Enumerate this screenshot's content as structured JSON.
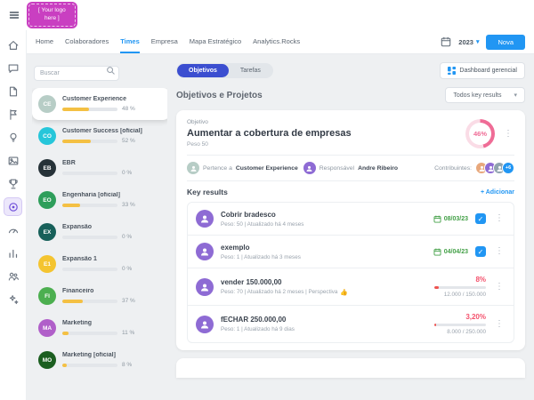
{
  "icons": {
    "kebab": "⋮",
    "check": "✓",
    "caret_down": "▾",
    "thumb_up": "👍"
  },
  "colors": {
    "logo_magenta": "#c93fc1",
    "accent_blue": "#2196f3",
    "pill_indigo": "#3b4ed0",
    "progress_yellow": "#f4c043",
    "danger_pink": "#f4516c",
    "ring_pink": "#ef6c96",
    "success_green": "#43a047",
    "active_icon_purple": "#6c4bd8"
  },
  "header": {
    "logo_line1": "[ Your logo",
    "logo_line2": "here ]"
  },
  "topnav": {
    "items": [
      {
        "label": "Home"
      },
      {
        "label": "Colaboradores"
      },
      {
        "label": "Times"
      },
      {
        "label": "Empresa"
      },
      {
        "label": "Mapa Estratégico"
      },
      {
        "label": "Analytics.Rocks"
      }
    ],
    "year": "2023",
    "new_button_label": "Nova"
  },
  "teams_panel": {
    "search_placeholder": "Buscar",
    "teams": [
      {
        "initials": "CE",
        "name": "Customer Experience",
        "percent": "48 %",
        "value": 48,
        "color": "#b7cdc6"
      },
      {
        "initials": "CO",
        "name": "Customer Success [oficial]",
        "percent": "52 %",
        "value": 52,
        "color": "#26c6da"
      },
      {
        "initials": "EB",
        "name": "EBR",
        "percent": "0 %",
        "value": 0,
        "color": "#263238"
      },
      {
        "initials": "EO",
        "name": "Engenharia [oficial]",
        "percent": "33 %",
        "value": 33,
        "color": "#2e9e5b"
      },
      {
        "initials": "EX",
        "name": "Expansão",
        "percent": "0 %",
        "value": 0,
        "color": "#17605a"
      },
      {
        "initials": "E1",
        "name": "Expansão 1",
        "percent": "0 %",
        "value": 0,
        "color": "#f4c430"
      },
      {
        "initials": "FI",
        "name": "Financeiro",
        "percent": "37 %",
        "value": 37,
        "color": "#4caf50"
      },
      {
        "initials": "MA",
        "name": "Marketing",
        "percent": "11 %",
        "value": 11,
        "color": "#b05fc9"
      },
      {
        "initials": "MO",
        "name": "Marketing [oficial]",
        "percent": "8 %",
        "value": 8,
        "color": "#1b5e20"
      }
    ]
  },
  "main": {
    "view_tabs": {
      "objetivos": "Objetivos",
      "tarefas": "Tarefas"
    },
    "dashboard_button_label": "Dashboard gerencial",
    "section_title": "Objetivos e Projetos",
    "filter_selected": "Todos key results",
    "objective": {
      "kind_label": "Objetivo",
      "title": "Aumentar a cobertura de empresas",
      "weight_label": "Peso 50",
      "progress_label": "46%",
      "progress_value": 46,
      "belongs_label": "Pertence a",
      "belongs_value": "Customer Experience",
      "owner_label": "Responsável",
      "owner_value": "Andre Ribeiro",
      "contributors_label": "Contribuintes:",
      "contributors_more": "+6",
      "key_results_header": "Key results",
      "add_label": "+ Adicionar",
      "key_results": [
        {
          "title": "Cobrir bradesco",
          "meta": "Peso: 50  |  Atualizado há 4 meses",
          "date": "08/03/23"
        },
        {
          "title": "exemplo",
          "meta": "Peso: 1  |  Atualizado há 3 meses",
          "date": "04/04/23"
        },
        {
          "title": "vender 150.000,00",
          "meta": "Peso: 70  |  Atualizado há 2 meses  |  Perspectiva",
          "percent": "8%",
          "progress_value": 8,
          "fraction": "12.000 / 150.000"
        },
        {
          "title": "fECHAR 250.000,00",
          "meta": "Peso: 1  |  Atualizado há 9 dias",
          "percent": "3,20%",
          "progress_value": 3.2,
          "fraction": "8.000 / 250.000"
        }
      ]
    }
  }
}
